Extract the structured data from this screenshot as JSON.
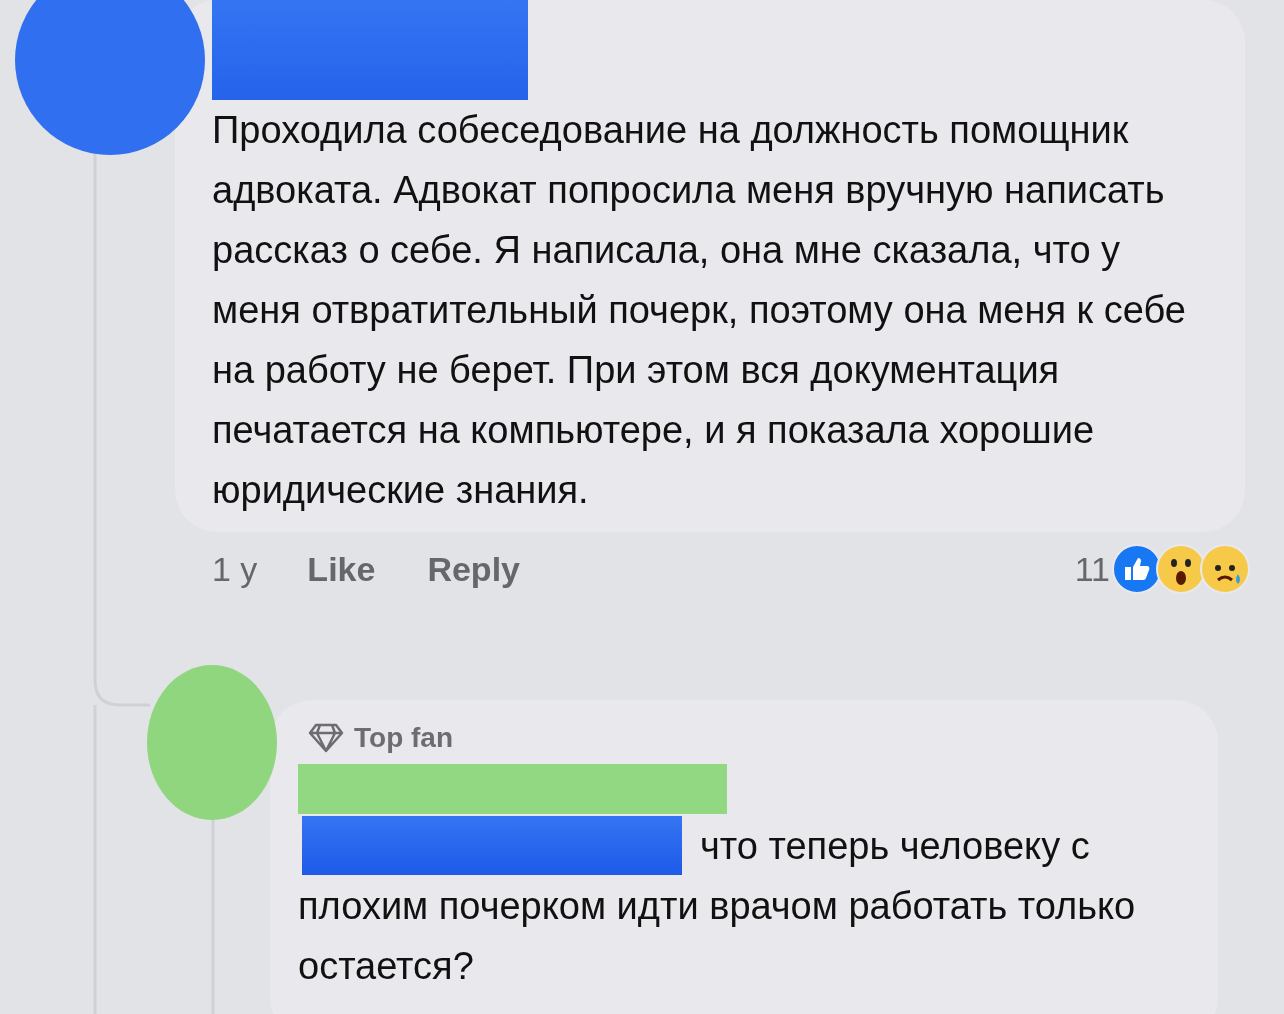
{
  "comment": {
    "text": "Проходила собеседование на должность помощник адвоката. Адвокат попросила меня вручную написать рассказ о себе. Я написала, она мне сказала, что у меня отвратительный почерк, поэтому она меня к себе на работу не берет. При этом вся документация печатается на компьютере, и я показала хорошие юридические знания.",
    "time": "1 y",
    "actions": [
      "Like",
      "Reply"
    ],
    "reaction_count": "11",
    "reactions": [
      {
        "kind": "like"
      },
      {
        "kind": "wow"
      },
      {
        "kind": "sad"
      }
    ]
  },
  "reply": {
    "badge": "Top fan",
    "text": "что теперь человеку с плохим почерком идти врачом работать только остается?"
  }
}
